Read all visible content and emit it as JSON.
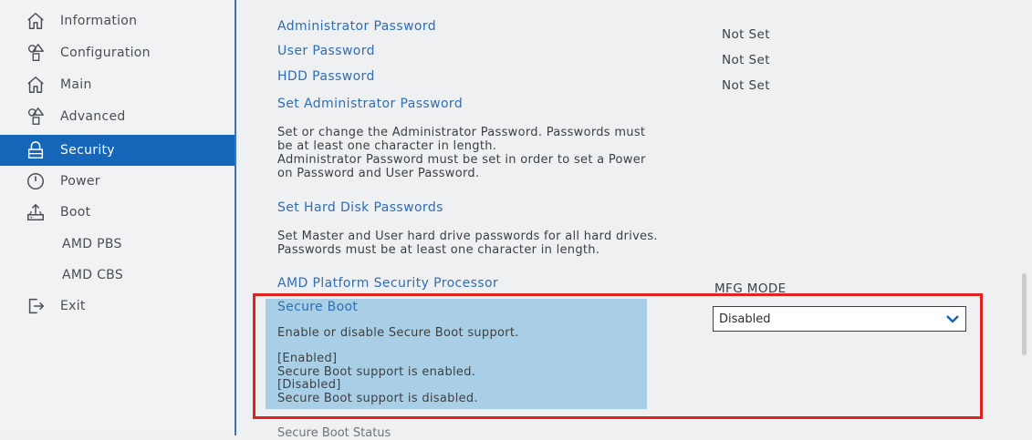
{
  "sidebar": {
    "items": [
      {
        "label": "Information",
        "icon": "home-icon"
      },
      {
        "label": "Configuration",
        "icon": "shapes-icon"
      },
      {
        "label": "Main",
        "icon": "home-icon"
      },
      {
        "label": "Advanced",
        "icon": "shapes-icon"
      },
      {
        "label": "Security",
        "icon": "lock-icon",
        "active": true
      },
      {
        "label": "Power",
        "icon": "power-icon"
      },
      {
        "label": "Boot",
        "icon": "boot-icon"
      },
      {
        "label": "AMD PBS",
        "icon": ""
      },
      {
        "label": "AMD CBS",
        "icon": ""
      },
      {
        "label": "Exit",
        "icon": "exit-icon"
      }
    ]
  },
  "main": {
    "admin_password": {
      "label": "Administrator Password",
      "value": "Not Set"
    },
    "user_password": {
      "label": "User Password",
      "value": "Not Set"
    },
    "hdd_password": {
      "label": "HDD Password",
      "value": "Not Set"
    },
    "set_admin_password": {
      "label": "Set Administrator Password",
      "desc": [
        "Set or change the Administrator Password. Passwords must",
        "be at least one character in length.",
        "Administrator Password must be set in order to set a Power",
        "on Password and User Password."
      ]
    },
    "set_hdd_passwords": {
      "label": "Set Hard Disk Passwords",
      "desc": [
        "Set Master and User hard drive passwords for all hard drives.",
        "Passwords must be at least one character in length."
      ]
    },
    "amd_psp": {
      "label": "AMD Platform Security Processor",
      "value": "MFG MODE"
    },
    "secure_boot": {
      "title": "Secure Boot",
      "help": "Enable or disable Secure Boot support.",
      "enabled_tag": "[Enabled]",
      "enabled_desc": "Secure Boot support is enabled.",
      "disabled_tag": "[Disabled]",
      "disabled_desc": "Secure Boot support is disabled.",
      "selected": "Disabled"
    },
    "secure_boot_status_label": "Secure Boot Status"
  },
  "colors": {
    "accent": "#1565b8",
    "link": "#2f6db5",
    "help_bg": "#a9cfe6",
    "highlight": "#e0231c"
  }
}
